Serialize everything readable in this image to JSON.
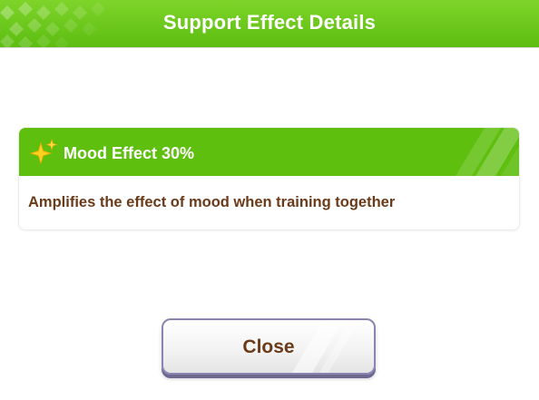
{
  "dialog": {
    "title": "Support Effect Details",
    "colors": {
      "header_green": "#5cbd10",
      "card_green": "#5fbf0f",
      "text_brown": "#6b3a19",
      "button_border": "#8a85b0"
    }
  },
  "effect": {
    "icon": "sparkle-icon",
    "title": "Mood Effect 30%",
    "description": "Amplifies the effect of mood when training together"
  },
  "footer": {
    "close_label": "Close"
  }
}
